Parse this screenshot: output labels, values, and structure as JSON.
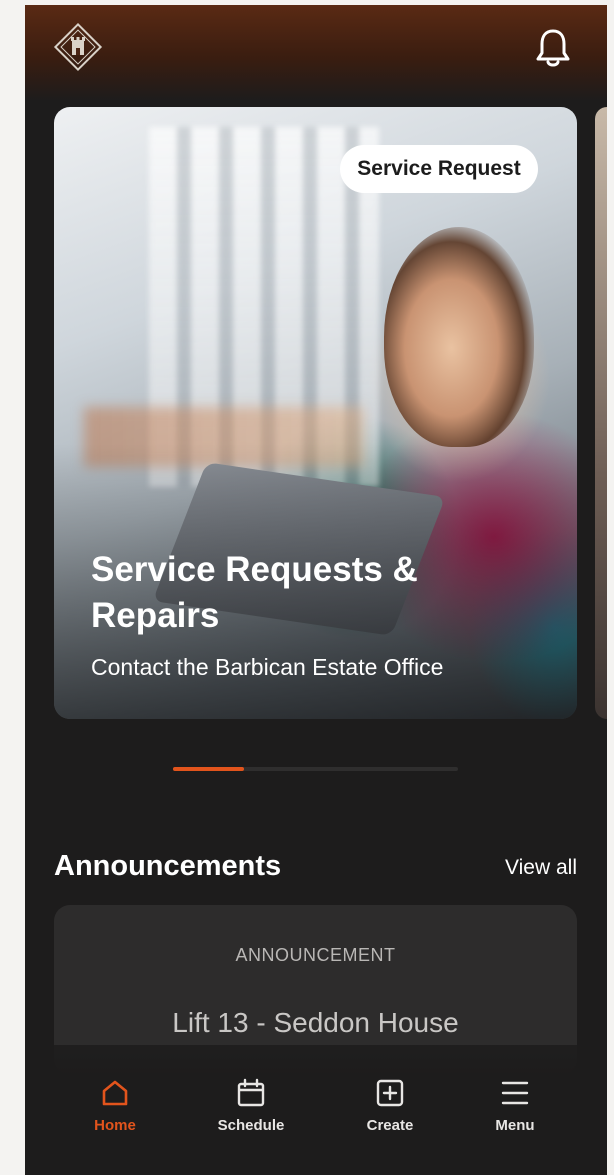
{
  "header": {
    "logo_icon": "estate-crest-icon",
    "notifications_icon": "bell-icon"
  },
  "hero": {
    "badge": "Service Request",
    "title": "Service Requests & Repairs",
    "subtitle": "Contact the Barbican Estate Office",
    "carousel_progress_fraction": 0.25
  },
  "announcements": {
    "heading": "Announcements",
    "view_all": "View all",
    "items": [
      {
        "label": "ANNOUNCEMENT",
        "title": "Lift 13 - Seddon House"
      }
    ]
  },
  "tabbar": {
    "items": [
      {
        "label": "Home",
        "icon": "home-icon",
        "active": true
      },
      {
        "label": "Schedule",
        "icon": "calendar-icon",
        "active": false
      },
      {
        "label": "Create",
        "icon": "plus-square-icon",
        "active": false
      },
      {
        "label": "Menu",
        "icon": "menu-icon",
        "active": false
      }
    ]
  },
  "colors": {
    "accent": "#e2541c",
    "background": "#1d1c1c",
    "card": "#2d2c2c"
  }
}
